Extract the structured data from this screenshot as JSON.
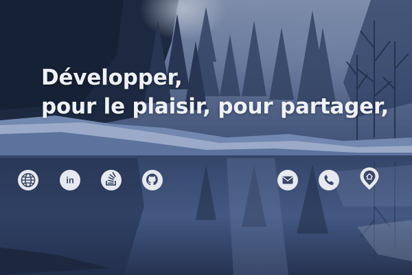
{
  "hero": {
    "headline_line1": "Développer,",
    "headline_line2": "pour le plaisir, pour partager,"
  },
  "social_links": [
    {
      "icon": "globe-icon"
    },
    {
      "icon": "linkedin-icon",
      "text": "in"
    },
    {
      "icon": "stackoverflow-icon"
    },
    {
      "icon": "github-icon"
    }
  ],
  "contact_links": [
    {
      "icon": "mail-icon"
    },
    {
      "icon": "phone-icon"
    },
    {
      "icon": "location-pin-icon"
    }
  ],
  "colors": {
    "icon_fill": "#e6e9ef",
    "icon_glyph": "#3a4766",
    "headline_text": "#eef1f7"
  }
}
